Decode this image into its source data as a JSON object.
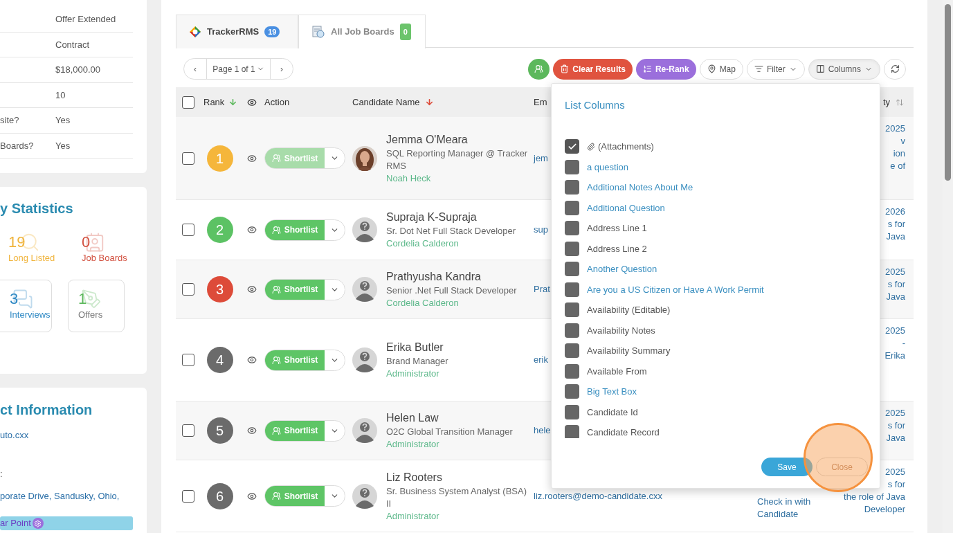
{
  "left_panel": {
    "details": [
      {
        "value": "Offer Extended"
      },
      {
        "value": "Contract"
      },
      {
        "value": "$18,000.00"
      },
      {
        "value": "10"
      },
      {
        "label": "site?",
        "value": "Yes"
      },
      {
        "label": "Boards?",
        "value": "Yes"
      }
    ],
    "statistics": {
      "title": "y Statistics",
      "items": [
        {
          "count": "19",
          "label": "Long Listed",
          "color": "#f0b43c",
          "kind": "plain",
          "label_muted": false
        },
        {
          "count": "0",
          "label": "Job Boards",
          "color": "#d2503f",
          "kind": "plain",
          "label_muted": false
        },
        {
          "count": "3",
          "label": "Interviews",
          "color": "#2d88c4",
          "kind": "boxed",
          "label_muted": false
        },
        {
          "count": "1",
          "label": "Offers",
          "color": "#5cb85c",
          "kind": "boxed",
          "label_muted": true
        }
      ]
    },
    "contact": {
      "title": "ct Information",
      "lines": [
        "uto.cxx",
        ":",
        "porate Drive, Sandusky, Ohio,"
      ],
      "badge": "ar Point"
    }
  },
  "tabs": [
    {
      "label": "TrackerRMS",
      "count": "19",
      "color": "#4a90e2",
      "selected": true
    },
    {
      "label": "All Job Boards",
      "count": "0",
      "color": "#6cc46c",
      "selected": false
    }
  ],
  "pager": {
    "prev": "‹",
    "page": "Page 1 of 1",
    "next": "›"
  },
  "toolbar": [
    {
      "kind": "shortlist"
    },
    {
      "kind": "clear",
      "label": "Clear Results"
    },
    {
      "kind": "rerank",
      "label": "Re-Rank"
    },
    {
      "kind": "map",
      "label": "Map"
    },
    {
      "kind": "filter",
      "label": "Filter",
      "expanded": false
    },
    {
      "kind": "columns",
      "label": "Columns",
      "expanded": true
    },
    {
      "kind": "refresh"
    }
  ],
  "table": {
    "header": {
      "select_all_checked": false,
      "rank": "Rank",
      "action": "Action",
      "candidate": "Candidate Name",
      "email": "Em",
      "column_9": "ty"
    },
    "rows": [
      {
        "checked": false,
        "rank": "1",
        "color": "#f5b63b",
        "shortlist": "Shortlist",
        "disabled": true,
        "name": "Jemma O'Meara",
        "title": "SQL Reporting Manager @ Tracker RMS",
        "owner": "Noah Heck",
        "email": "jem",
        "column_9": [
          "2025",
          "v",
          "ion",
          "e of"
        ]
      },
      {
        "checked": false,
        "rank": "2",
        "color": "#5cc264",
        "shortlist": "Shortlist",
        "disabled": false,
        "avatar": {
          "kind": "placeholder"
        },
        "name": "Supraja K-Supraja",
        "title": "Sr. Dot Net Full Stack Developer",
        "owner": "Cordelia Calderon",
        "email": "sup",
        "column_9": [
          "2026",
          "s for",
          "Java"
        ]
      },
      {
        "checked": false,
        "rank": "3",
        "color": "#dd4b39",
        "shortlist": "Shortlist",
        "disabled": false,
        "avatar": {
          "kind": "placeholder"
        },
        "name": "Prathyusha Kandra",
        "title": "Senior .Net Full Stack Developer",
        "owner": "Cordelia Calderon",
        "email": "Prat",
        "column_9": [
          "2025",
          "s for",
          "Java"
        ]
      },
      {
        "checked": false,
        "rank": "4",
        "color": "#6b6b6b",
        "shortlist": "Shortlist",
        "disabled": false,
        "avatar": {
          "kind": "placeholder"
        },
        "name": "Erika Butler",
        "title": "Brand Manager",
        "owner": "Administrator",
        "email": "erik",
        "column_9": [
          "2025",
          "-",
          "Erika"
        ]
      },
      {
        "checked": false,
        "rank": "5",
        "color": "#6b6b6b",
        "shortlist": "Shortlist",
        "disabled": false,
        "avatar": {
          "kind": "placeholder"
        },
        "name": "Helen Law",
        "title": "O2C Global Transition Manager",
        "owner": "Administrator",
        "email": "hele",
        "column_9": [
          "2025",
          "s for",
          "Java"
        ]
      },
      {
        "checked": false,
        "rank": "6",
        "color": "#6b6b6b",
        "shortlist": "Shortlist",
        "disabled": false,
        "avatar": {
          "kind": "placeholder"
        },
        "name": "Liz Rooters",
        "title": "Sr. Business System Analyst (BSA) II",
        "owner": "Administrator",
        "email": "liz.rooters@demo-candidate.cxx",
        "column_8": "Check in with Candidate",
        "column_9": [
          "2025",
          "s for",
          "the role of Java",
          "Developer"
        ]
      }
    ]
  },
  "list_columns": {
    "title": "List Columns",
    "items": [
      {
        "label": "(Attachments)",
        "kind": "attachment",
        "checked": true
      },
      {
        "label": "a question",
        "kind": "custom",
        "checked": false
      },
      {
        "label": "Additional Notes About Me",
        "kind": "custom",
        "checked": false
      },
      {
        "label": "Additional Question",
        "kind": "custom",
        "checked": false
      },
      {
        "label": "Address Line 1",
        "kind": "standard",
        "checked": false
      },
      {
        "label": "Address Line 2",
        "kind": "standard",
        "checked": false
      },
      {
        "label": "Another Question",
        "kind": "custom",
        "checked": false
      },
      {
        "label": "Are you a US Citizen or Have A Work Permit",
        "kind": "custom",
        "checked": false
      },
      {
        "label": "Availability (Editable)",
        "kind": "standard",
        "checked": false
      },
      {
        "label": "Availability Notes",
        "kind": "standard",
        "checked": false
      },
      {
        "label": "Availability Summary",
        "kind": "standard",
        "checked": false
      },
      {
        "label": "Available From",
        "kind": "standard",
        "checked": false
      },
      {
        "label": "Big Text Box",
        "kind": "custom",
        "checked": false
      },
      {
        "label": "Candidate Id",
        "kind": "standard",
        "checked": false
      },
      {
        "label": "Candidate Record",
        "kind": "standard",
        "checked": false
      }
    ],
    "save": "Save",
    "close": "Close"
  }
}
